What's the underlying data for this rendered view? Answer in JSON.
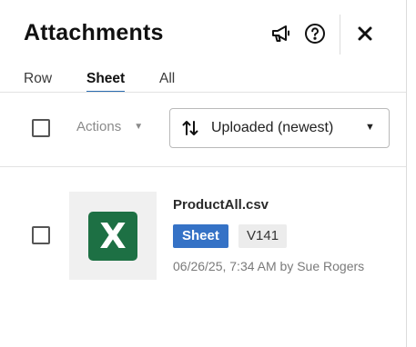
{
  "header": {
    "title": "Attachments",
    "icons": [
      "megaphone-icon",
      "help-icon",
      "close-icon"
    ]
  },
  "tabs": [
    {
      "label": "Row",
      "active": false
    },
    {
      "label": "Sheet",
      "active": true
    },
    {
      "label": "All",
      "active": false
    }
  ],
  "toolbar": {
    "actions_label": "Actions",
    "sort": {
      "selected": "Uploaded (newest)"
    }
  },
  "attachments": [
    {
      "filename": "ProductAll.csv",
      "file_icon": "excel-icon",
      "file_icon_letter": "X",
      "scope_badge": "Sheet",
      "version": "V141",
      "meta": "06/26/25, 7:34 AM by Sue Rogers"
    }
  ],
  "colors": {
    "accent": "#3572c6",
    "tab_underline": "#2b6cb0",
    "excel_green": "#1d7044"
  }
}
